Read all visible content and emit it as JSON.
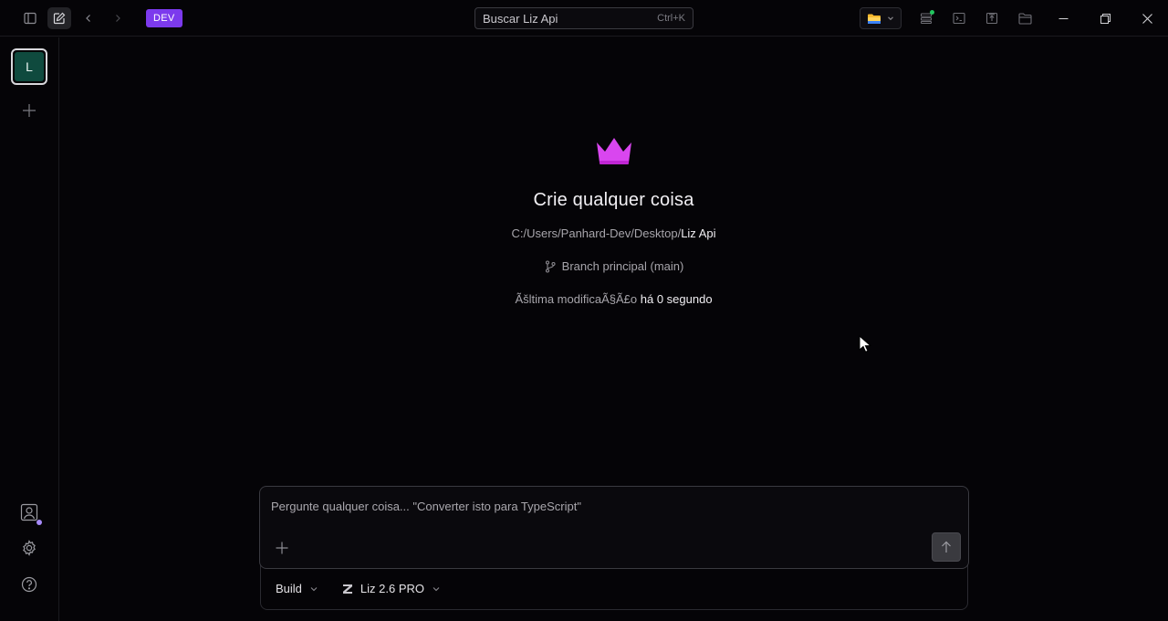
{
  "titlebar": {
    "dev_badge": "DEV",
    "search_placeholder": "Buscar Liz Api",
    "search_shortcut": "Ctrl+K"
  },
  "sidebar": {
    "workspace_initial": "L"
  },
  "hero": {
    "title": "Crie qualquer coisa",
    "path_prefix": "C:/Users/Panhard-Dev/Desktop/",
    "path_project": "Liz Api",
    "branch": "Branch principal (main)",
    "modified_label": "Ãšltima modificaÃ§Ã£o",
    "modified_value": "há 0 segundo"
  },
  "composer": {
    "placeholder": "Pergunte qualquer coisa... \"Converter isto para TypeScript\"",
    "mode_label": "Build",
    "model_label": "Liz 2.6 PRO"
  },
  "colors": {
    "accent": "#7c3aed",
    "crown": "#d946ef",
    "workspace": "#0f4a3e",
    "status_green": "#22c55e"
  },
  "icons": {
    "crown": "crown-icon",
    "branch": "git-branch-icon",
    "send": "arrow-up-icon"
  }
}
